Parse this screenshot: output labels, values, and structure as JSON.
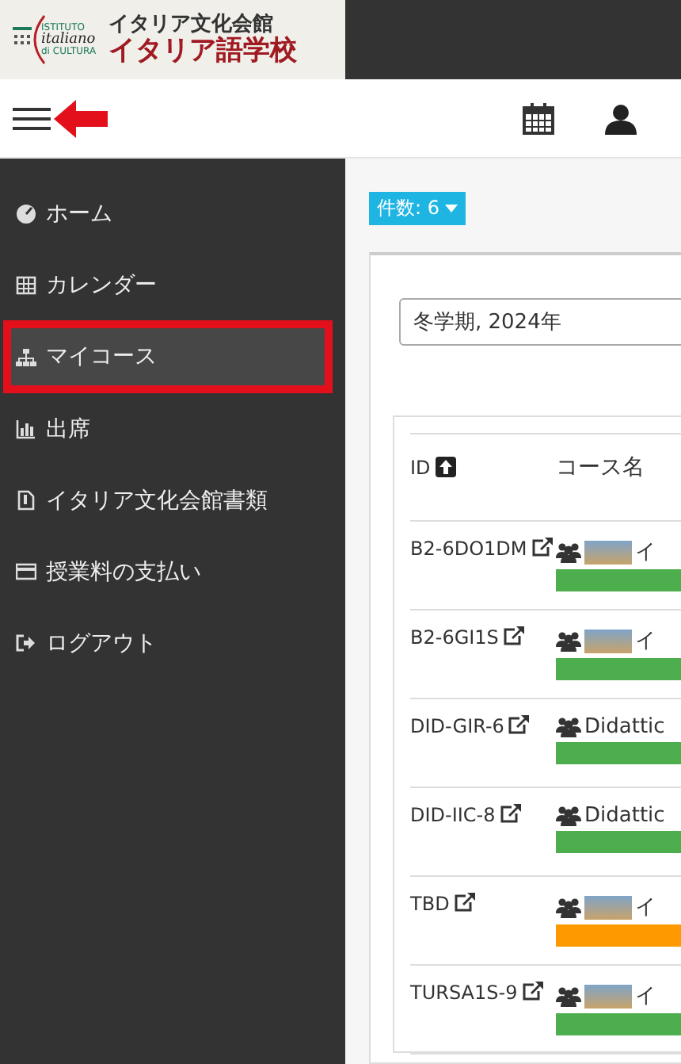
{
  "logo": {
    "institute_lines": [
      "ISTITUTO",
      "italiano",
      "di CULTURA"
    ],
    "title_top": "イタリア文化会館",
    "title_bottom": "イタリア語学校"
  },
  "sidebar": {
    "items": [
      {
        "label": "ホーム",
        "selected": false
      },
      {
        "label": "カレンダー",
        "selected": false
      },
      {
        "label": "マイコース",
        "selected": true
      },
      {
        "label": "出席",
        "selected": false
      },
      {
        "label": "イタリア文化会館書類",
        "selected": false
      },
      {
        "label": "授業料の支払い",
        "selected": false
      },
      {
        "label": "ログアウト",
        "selected": false
      }
    ]
  },
  "count_badge": "件数: 6",
  "term_select": {
    "value": "冬学期, 2024年"
  },
  "table": {
    "columns": [
      "ID",
      "コース名"
    ],
    "rows": [
      {
        "id": "B2-6DO1DM",
        "name": "イ",
        "photo": true,
        "color": "#4cae4c"
      },
      {
        "id": "B2-6GI1S",
        "name": "イ",
        "photo": true,
        "color": "#4cae4c"
      },
      {
        "id": "DID-GIR-6",
        "name": "Didattic",
        "photo": false,
        "color": "#4cae4c"
      },
      {
        "id": "DID-IIC-8",
        "name": "Didattic",
        "photo": false,
        "color": "#4cae4c"
      },
      {
        "id": "TBD",
        "name": "イ",
        "photo": true,
        "color": "#ff9900"
      },
      {
        "id": "TURSA1S-9",
        "name": "イ",
        "photo": true,
        "color": "#4cae4c"
      }
    ]
  }
}
